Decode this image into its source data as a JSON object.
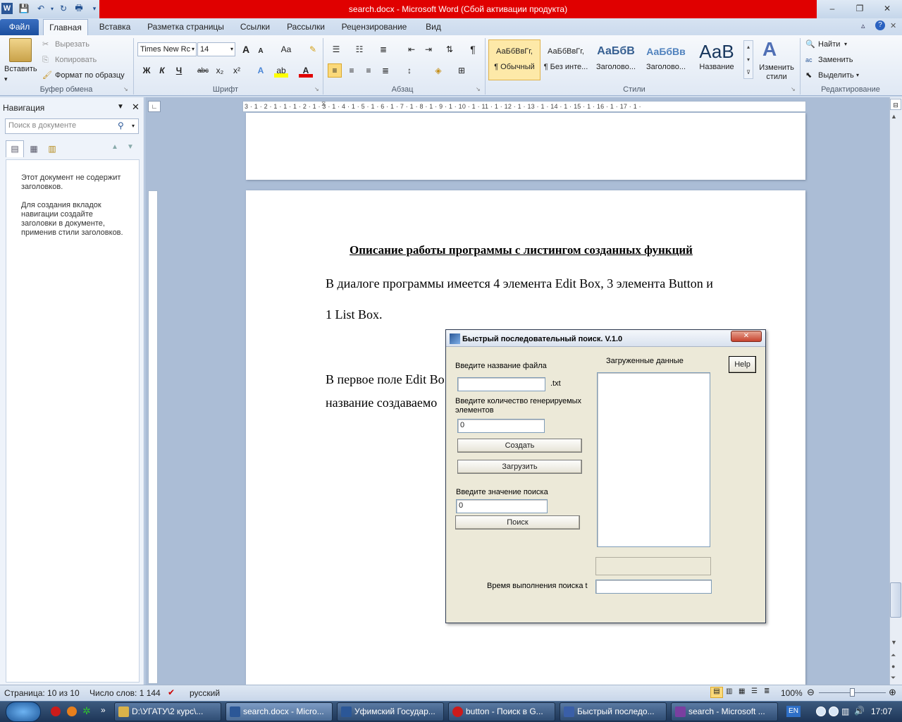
{
  "window": {
    "title": "search.docx - Microsoft Word (Сбой активации продукта)",
    "minimize": "‒",
    "maximize": "❐",
    "close": "✕"
  },
  "tabs": [
    "Файл",
    "Главная",
    "Вставка",
    "Разметка страницы",
    "Ссылки",
    "Рассылки",
    "Рецензирование",
    "Вид"
  ],
  "ribbon": {
    "clipboard": {
      "paste": "Вставить",
      "cut": "Вырезать",
      "copy": "Копировать",
      "format_painter": "Формат по образцу",
      "label": "Буфер обмена"
    },
    "font": {
      "name": "Times New Rc",
      "size": "14",
      "label": "Шрифт",
      "bold": "Ж",
      "italic": "К",
      "underline": "Ч",
      "strike": "abc",
      "sub": "x₂",
      "sup": "x²",
      "grow": "A",
      "shrink": "A",
      "case": "Aa"
    },
    "paragraph": {
      "label": "Абзац"
    },
    "styles": {
      "label": "Стили",
      "items": [
        {
          "preview": "АаБбВвГг,",
          "name": "¶ Обычный"
        },
        {
          "preview": "АаБбВвГг,",
          "name": "¶ Без инте..."
        },
        {
          "preview": "АаБбВ",
          "name": "Заголово..."
        },
        {
          "preview": "АаБбВв",
          "name": "Заголово..."
        },
        {
          "preview": "АаВ",
          "name": "Название"
        }
      ],
      "change": "Изменить стили"
    },
    "editing": {
      "find": "Найти",
      "replace": "Заменить",
      "select": "Выделить",
      "label": "Редактирование"
    }
  },
  "nav": {
    "title": "Навигация",
    "search_placeholder": "Поиск в документе",
    "msg1": "Этот документ не содержит заголовков.",
    "msg2": "Для создания вкладок навигации создайте заголовки в документе, применив стили заголовков."
  },
  "ruler": {
    "marks": "3 · 1 · 2 · 1 · 1 · 1 · 2 · 1 · 3 · 1 · 4 · 1 · 5 · 1 · 6 · 1 · 7 · 1 · 8 · 1 · 9 · 1 · 10 · 1 · 11 · 1 · 12 · 1 · 13 · 1 · 14 · 1 · 15 · 1 · 16 · 1 · 17 · 1 ·"
  },
  "document": {
    "heading": "Описание работы программы с листингом созданных функций",
    "line1": "В диалоге программы имеется 4 элемента Edit Box, 3 элемента Button  и",
    "line2": "1 List Box.",
    "line3": "В первое поле Edit Bo",
    "line4": "название создаваемо"
  },
  "dialog": {
    "title": "Быстрый последовательный поиск. V.1.0",
    "file_label": "Введите название файла",
    "file_value": "",
    "ext": ".txt",
    "count_label": "Введите количество генерируемых элементов",
    "count_value": "0",
    "create_btn": "Создать",
    "load_btn": "Загрузить",
    "search_label": "Введите значение поиска",
    "search_value": "0",
    "search_btn": "Поиск",
    "loaded_label": "Загруженные данные",
    "help_btn": "Help",
    "time_label": "Время выполнения поиска t",
    "time_value": ""
  },
  "status": {
    "page": "Страница: 10 из 10",
    "words": "Число слов: 1 144",
    "lang": "русский",
    "zoom": "100%"
  },
  "taskbar": {
    "items": [
      {
        "label": "D:\\УГАТУ\\2 курс\\...",
        "color": "#d9b24a"
      },
      {
        "label": "search.docx - Micro...",
        "color": "#2b5797"
      },
      {
        "label": "Уфимский Государ...",
        "color": "#2b5797"
      },
      {
        "label": "button - Поиск в G...",
        "color": "#cc1b1b"
      },
      {
        "label": "Быстрый последо...",
        "color": "#3a5fa8"
      },
      {
        "label": "search - Microsoft ...",
        "color": "#7a3fa0"
      }
    ],
    "lang": "EN",
    "time": "17:07"
  }
}
